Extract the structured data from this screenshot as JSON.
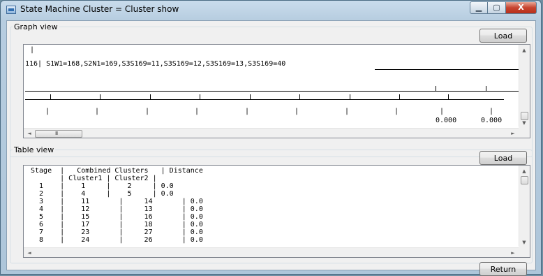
{
  "window": {
    "title": "State Machine Cluster = Cluster show",
    "minimize_glyph": "▁",
    "maximize_glyph": "▢",
    "close_glyph": "X"
  },
  "graph_view": {
    "label": "Graph view",
    "load_label": "Load",
    "top_marker": "|",
    "line_text": "116| S1W1=168,S2N1=169,S3S169=11,S3S169=12,S3S169=13,S3S169=40",
    "tick_glyph": "|",
    "value_left": "0.000",
    "value_right": "0.000",
    "hscroll_thumb_glyph": "III"
  },
  "table_view": {
    "label": "Table view",
    "load_label": "Load",
    "header_line1": "Stage  |   Combined Clusters   | Distance",
    "header_line2": "       | Cluster1 | Cluster2 |",
    "rows": [
      "  1    |    1     |    2     | 0.0",
      "  2    |    4     |    5     | 0.0",
      "  3    |    11       |     14       | 0.0",
      "  4    |    12       |     13       | 0.0",
      "  5    |    15       |     16       | 0.0",
      "  6    |    17       |     18       | 0.0",
      "  7    |    23       |     27       | 0.0",
      "  8    |    24       |     26       | 0.0"
    ]
  },
  "footer": {
    "return_label": "Return"
  },
  "icons": {
    "app": "app-icon",
    "scroll_up": "▲",
    "scroll_down": "▼",
    "scroll_left": "◄",
    "scroll_right": "►"
  }
}
